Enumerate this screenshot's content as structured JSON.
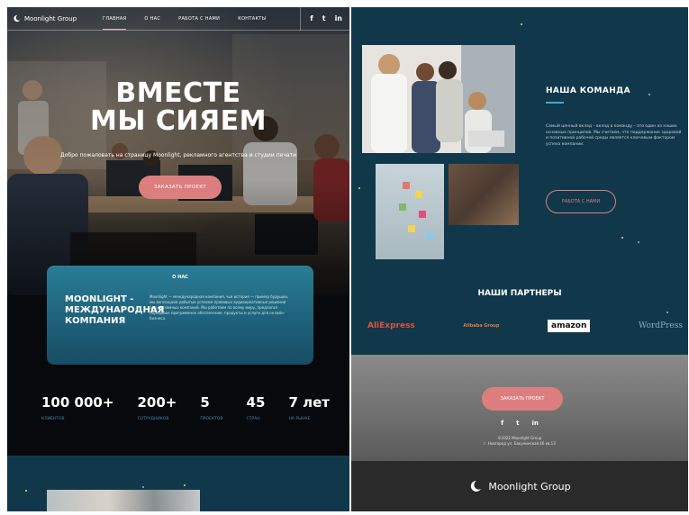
{
  "left": {
    "nav": {
      "logo_text": "Moonlight Group",
      "links": [
        "ГЛАВНАЯ",
        "О НАС",
        "РАБОТА С НАМИ",
        "КОНТАКТЫ"
      ],
      "social": [
        "f",
        "t",
        "in"
      ]
    },
    "hero": {
      "title_line1": "ВМЕСТЕ",
      "title_line2": "МЫ СИЯЕМ",
      "subtitle": "Добро пожаловать на страницу Moonlight, рекламного агентства и студии печати",
      "button": "ЗАКАЗАТЬ ПРОЕКТ"
    },
    "about": {
      "heading": "О НАС",
      "name": "MOONLIGHT - МЕЖДУНАРОДНАЯ КОМПАНИЯ",
      "text": "Moonlight — международная компания, чья история — пример будущих, мы воплощаем добытые успехом правовых аудиокреативных решений для рекламных компаний. Мы работаем по всему миру, предлагая передовое программное обеспечение, продукты и услуги для онлайн-бизнеса."
    },
    "stats": [
      {
        "num": "100 000+",
        "label": "КЛИЕНТОВ"
      },
      {
        "num": "200+",
        "label": "СОТРУДНИКОВ"
      },
      {
        "num": "5",
        "label": "ПРОЕКТОВ"
      },
      {
        "num": "45",
        "label": "СТРАН"
      },
      {
        "num": "7 лет",
        "label": "НА РЫНКЕ"
      }
    ]
  },
  "right": {
    "team": {
      "title": "НАША КОМАНДА",
      "text": "Самый ценный вклад – вклад в команду – это один из наших основных принципов. Мы считаем, что поддержание здоровой и позитивной рабочей среды является ключевым фактором успеха компании.",
      "button": "РАБОТА С НАМИ"
    },
    "partners": {
      "title": "НАШИ ПАРТНЕРЫ",
      "items": [
        "AliExpress",
        "Alibaba Group",
        "amazon",
        "WordPress"
      ]
    },
    "footer": {
      "button": "ЗАКАЗАТЬ ПРОЕКТ",
      "social": [
        "f",
        "t",
        "in"
      ],
      "copy_line1": "©2022 Moonlight Group",
      "copy_line2": "г. Новгород ул. Бакунинская 46 кв.13",
      "brand": "Moonlight Group"
    }
  },
  "colors": {
    "accent": "#dd7e7e",
    "teal_dark": "#10384a",
    "teal_card": "#2a7d96",
    "stat_label": "#3c8ba8"
  }
}
